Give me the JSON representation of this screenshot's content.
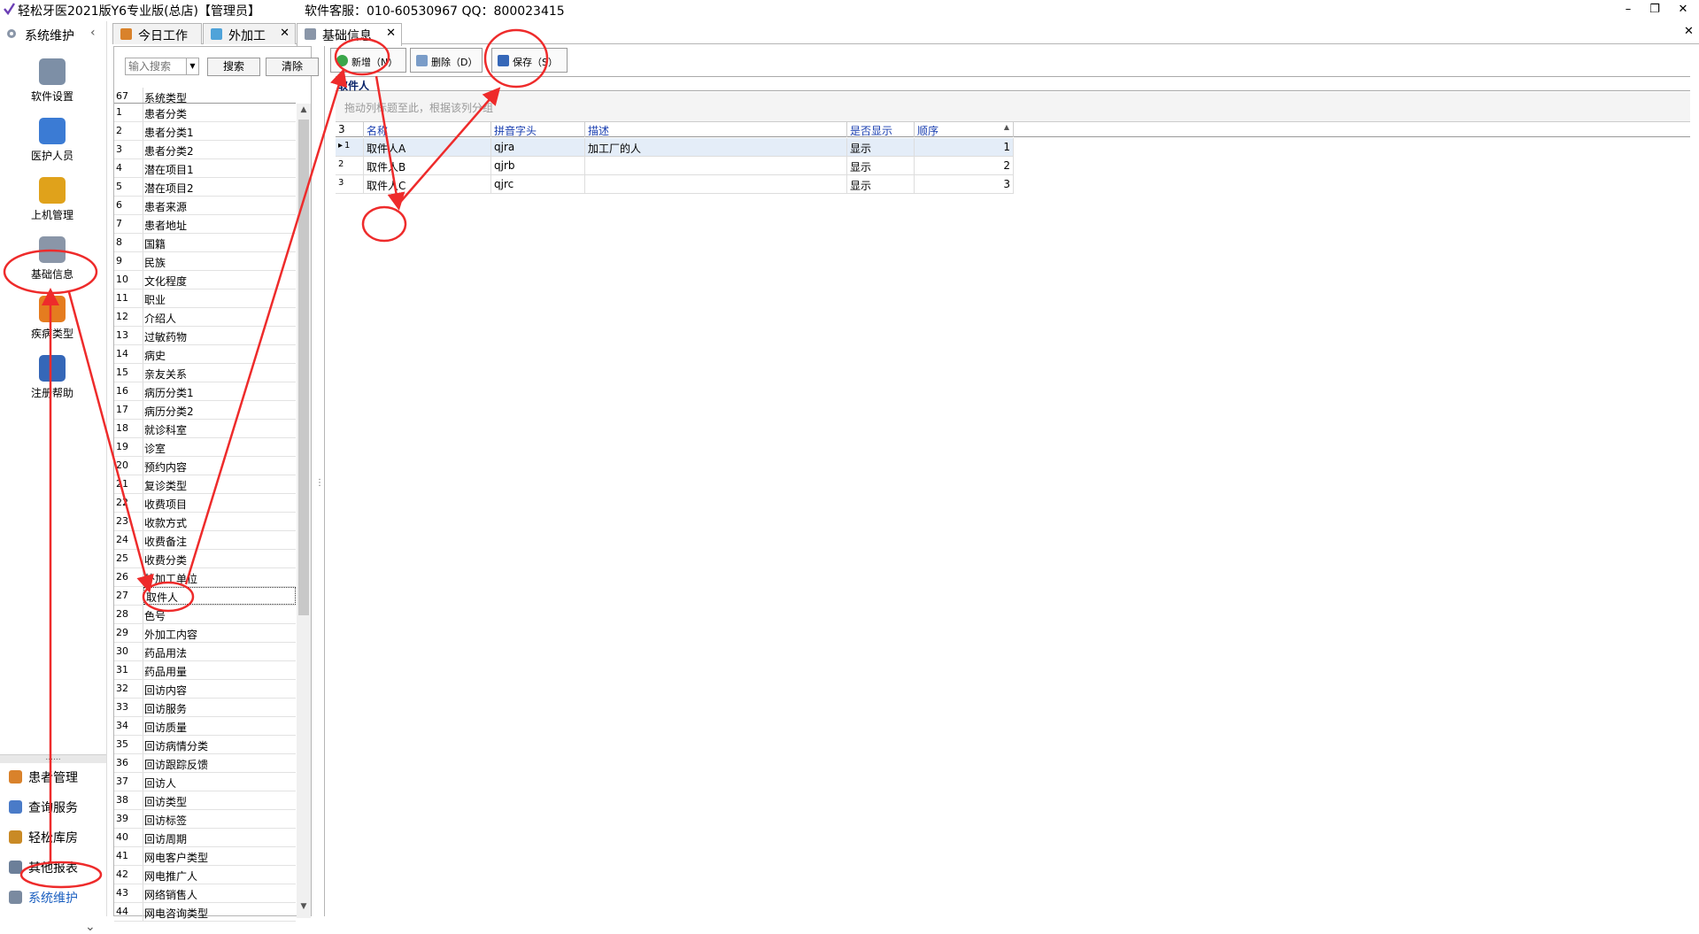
{
  "window": {
    "title": "轻松牙医2021版Y6专业版(总店)【管理员】",
    "support": "软件客服：010-60530967  QQ：800023415",
    "minimize": "–",
    "restore": "❐",
    "close": "✕"
  },
  "leftnav": {
    "header": "系统维护",
    "collapse": "‹",
    "tools": [
      {
        "label": "软件设置",
        "icon": "gears-icon",
        "color": "#7d8fa6"
      },
      {
        "label": "医护人员",
        "icon": "staff-icon",
        "color": "#3b7bd4"
      },
      {
        "label": "上机管理",
        "icon": "lock-icon",
        "color": "#e0a21b"
      },
      {
        "label": "基础信息",
        "icon": "basic-info-icon",
        "color": "#8a96a8"
      },
      {
        "label": "疾病类型",
        "icon": "disease-icon",
        "color": "#e57c1f"
      },
      {
        "label": "注册帮助",
        "icon": "help-book-icon",
        "color": "#3567b8"
      }
    ],
    "splitter": "......",
    "modules": [
      {
        "label": "患者管理",
        "icon": "patients-icon",
        "color": "#d9822b"
      },
      {
        "label": "查询服务",
        "icon": "query-icon",
        "color": "#4a7bc8"
      },
      {
        "label": "轻松库房",
        "icon": "warehouse-icon",
        "color": "#c98a25"
      },
      {
        "label": "其他报表",
        "icon": "report-icon",
        "color": "#6c7f99"
      },
      {
        "label": "系统维护",
        "icon": "system-icon",
        "color": "#7a8aa0"
      }
    ],
    "more": "⌄"
  },
  "tabs": [
    {
      "label": "今日工作",
      "icon": "today-icon",
      "color": "#d9822b"
    },
    {
      "label": "外加工",
      "icon": "outsource-icon",
      "color": "#4fa3d9",
      "close": "✕"
    },
    {
      "label": "基础信息",
      "icon": "basic-info-icon",
      "color": "#8a96a8",
      "close": "✕"
    }
  ],
  "tabs_close_all": "✕",
  "typepanel": {
    "search_placeholder": "输入搜索",
    "search_button": "搜索",
    "clear_button": "清除",
    "count": "67",
    "column": "系统类型",
    "rows": [
      [
        "1",
        "患者分类"
      ],
      [
        "2",
        "患者分类1"
      ],
      [
        "3",
        "患者分类2"
      ],
      [
        "4",
        "潜在项目1"
      ],
      [
        "5",
        "潜在项目2"
      ],
      [
        "6",
        "患者来源"
      ],
      [
        "7",
        "患者地址"
      ],
      [
        "8",
        "国籍"
      ],
      [
        "9",
        "民族"
      ],
      [
        "10",
        "文化程度"
      ],
      [
        "11",
        "职业"
      ],
      [
        "12",
        "介绍人"
      ],
      [
        "13",
        "过敏药物"
      ],
      [
        "14",
        "病史"
      ],
      [
        "15",
        "亲友关系"
      ],
      [
        "16",
        "病历分类1"
      ],
      [
        "17",
        "病历分类2"
      ],
      [
        "18",
        "就诊科室"
      ],
      [
        "19",
        "诊室"
      ],
      [
        "20",
        "预约内容"
      ],
      [
        "21",
        "复诊类型"
      ],
      [
        "22",
        "收费项目"
      ],
      [
        "23",
        "收款方式"
      ],
      [
        "24",
        "收费备注"
      ],
      [
        "25",
        "收费分类"
      ],
      [
        "26",
        "外加工单位"
      ],
      [
        "27",
        "取件人"
      ],
      [
        "28",
        "色号"
      ],
      [
        "29",
        "外加工内容"
      ],
      [
        "30",
        "药品用法"
      ],
      [
        "31",
        "药品用量"
      ],
      [
        "32",
        "回访内容"
      ],
      [
        "33",
        "回访服务"
      ],
      [
        "34",
        "回访质量"
      ],
      [
        "35",
        "回访病情分类"
      ],
      [
        "36",
        "回访跟踪反馈"
      ],
      [
        "37",
        "回访人"
      ],
      [
        "38",
        "回访类型"
      ],
      [
        "39",
        "回访标签"
      ],
      [
        "40",
        "回访周期"
      ],
      [
        "41",
        "网电客户类型"
      ],
      [
        "42",
        "网电推广人"
      ],
      [
        "43",
        "网络销售人"
      ],
      [
        "44",
        "网电咨询类型"
      ]
    ],
    "selected_index": 26
  },
  "detail": {
    "toolbar": {
      "add": "新增（N）",
      "delete": "删除（D）",
      "save": "保存（S）"
    },
    "title": "取件人",
    "group_hint": "拖动列标题至此，根据该列分组",
    "count": "3",
    "columns": [
      "名称",
      "拼音字头",
      "描述",
      "是否显示",
      "顺序"
    ],
    "sort_indicator": "▲",
    "rows": [
      {
        "name": "取件人A",
        "pinyin": "qjra",
        "desc": "加工厂的人",
        "show": "显示",
        "order": "1"
      },
      {
        "name": "取件人B",
        "pinyin": "qjrb",
        "desc": "",
        "show": "显示",
        "order": "2"
      },
      {
        "name": "取件人C",
        "pinyin": "qjrc",
        "desc": "",
        "show": "显示",
        "order": "3"
      }
    ],
    "row_pointer": "▸"
  },
  "annotation_color": "#ee2b2b"
}
